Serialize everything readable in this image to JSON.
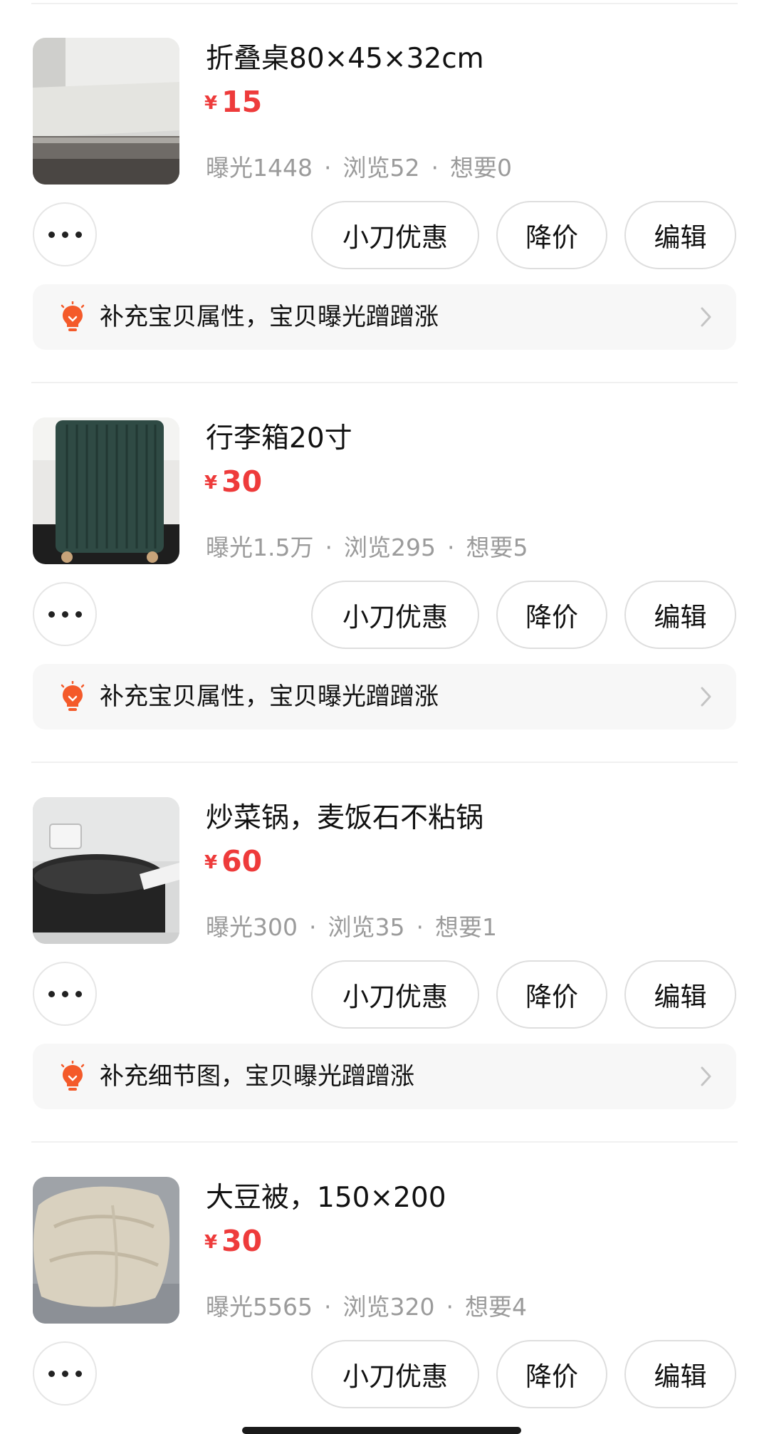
{
  "common": {
    "more_icon": "ellipsis-icon",
    "tip_icon": "lightbulb-icon",
    "chevron_icon": "chevron-right-icon",
    "currency": "¥",
    "btn_coupon": "小刀优惠",
    "btn_price_cut": "降价",
    "btn_edit": "编辑",
    "accent_color": "#ee3b3b",
    "tip_icon_color": "#f45a2a"
  },
  "items": [
    {
      "title": "折叠桌80×45×32cm",
      "price": "15",
      "exposure": "曝光1448",
      "views": "浏览52",
      "wants": "想要0",
      "tip": "补充宝贝属性，宝贝曝光蹭蹭涨",
      "thumb": "folding-table-photo"
    },
    {
      "title": "行李箱20寸",
      "price": "30",
      "exposure": "曝光1.5万",
      "views": "浏览295",
      "wants": "想要5",
      "tip": "补充宝贝属性，宝贝曝光蹭蹭涨",
      "thumb": "suitcase-photo"
    },
    {
      "title": "炒菜锅，麦饭石不粘锅",
      "price": "60",
      "exposure": "曝光300",
      "views": "浏览35",
      "wants": "想要1",
      "tip": "补充细节图，宝贝曝光蹭蹭涨",
      "thumb": "wok-pan-photo"
    },
    {
      "title": "大豆被，150×200",
      "price": "30",
      "exposure": "曝光5565",
      "views": "浏览320",
      "wants": "想要4",
      "thumb": "quilt-photo"
    }
  ]
}
